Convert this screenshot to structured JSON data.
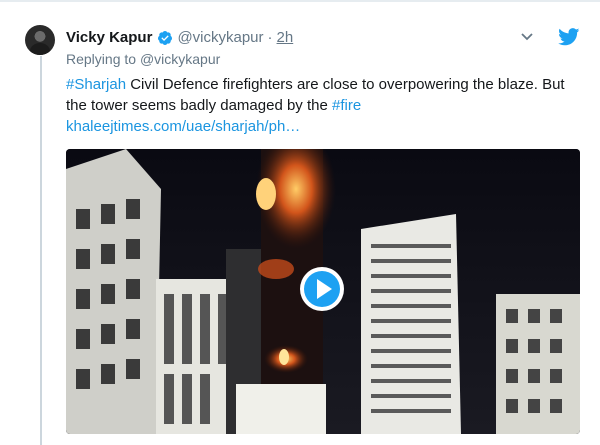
{
  "tweet": {
    "author_name": "Vicky Kapur",
    "author_handle": "@vickykapur",
    "separator": "·",
    "timestamp": "2h",
    "replying_prefix": "Replying to ",
    "replying_to": "@vickykapur",
    "text": {
      "tag1": "#Sharjah",
      "part1": " Civil Defence firefighters are close to overpowering the blaze. But the tower seems badly damaged by the ",
      "tag2": "#fire",
      "link": "khaleejtimes.com/uae/sharjah/ph…"
    }
  },
  "icons": {
    "verified": "verified-badge-icon",
    "brand": "twitter-bird-icon",
    "menu": "chevron-down-icon",
    "media_play": "play-icon"
  },
  "colors": {
    "link": "#1b95e0",
    "text": "#14171a",
    "muted": "#657786",
    "twitter_blue": "#1da1f2",
    "thread_line": "#ccd6dd"
  }
}
